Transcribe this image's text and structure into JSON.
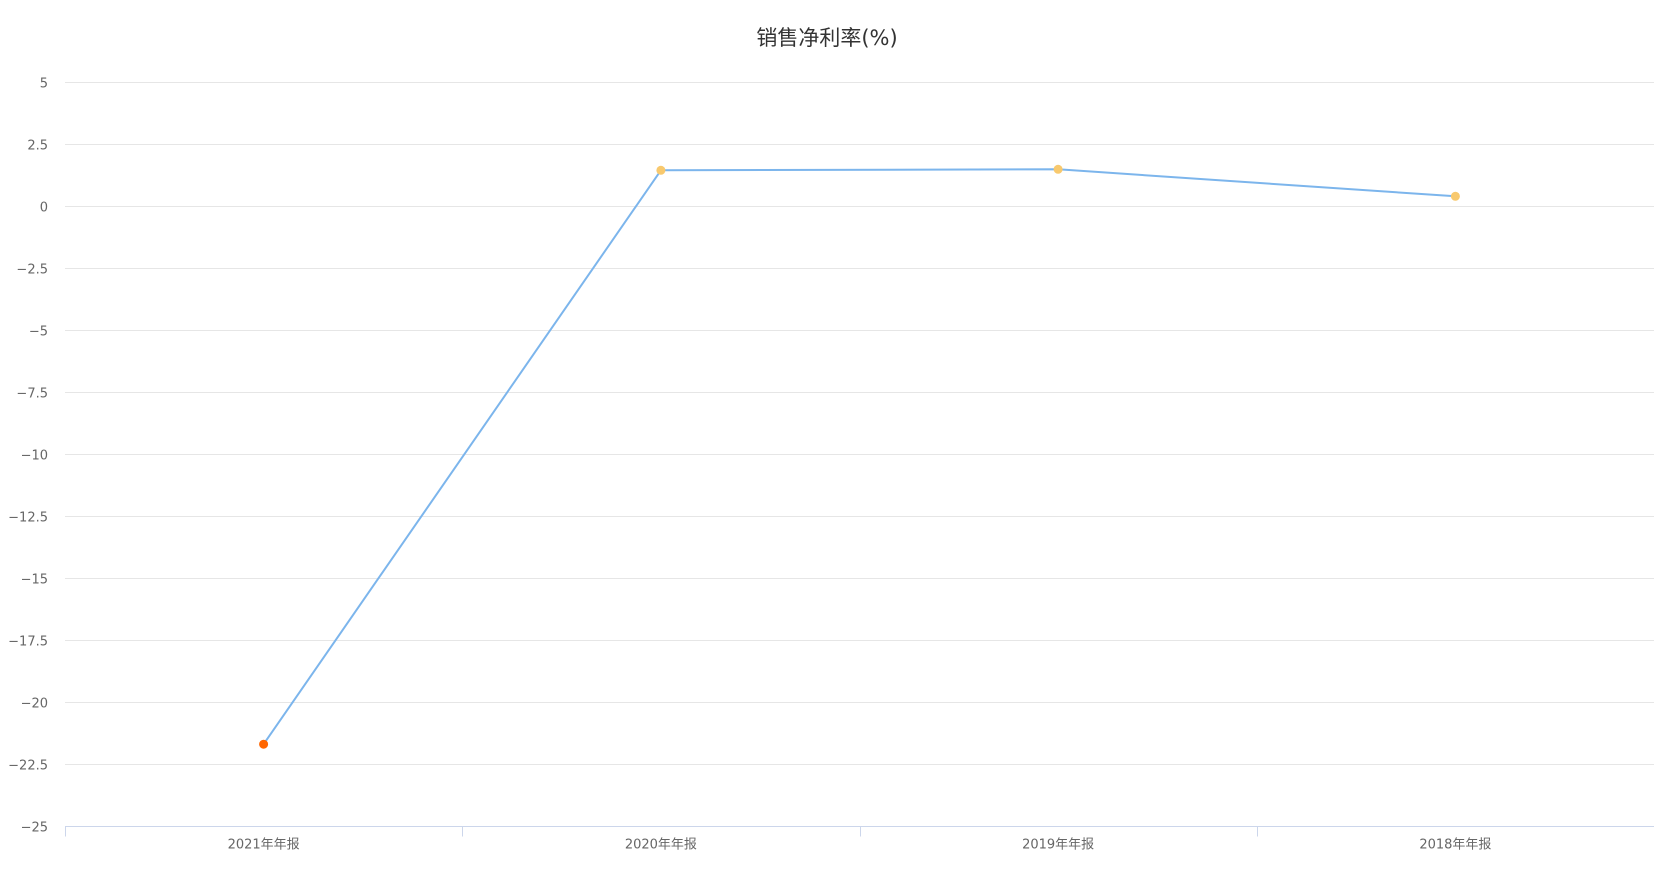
{
  "chart_data": {
    "type": "line",
    "title": "销售净利率(%)",
    "xlabel": "",
    "ylabel": "",
    "categories": [
      "2021年年报",
      "2020年年报",
      "2019年年报",
      "2018年年报"
    ],
    "series": [
      {
        "values": [
          -21.7,
          1.44,
          1.48,
          0.39
        ],
        "color": "#7cb5ec"
      }
    ],
    "point_colors": [
      "#ff6600",
      "#f8c96e",
      "#f8c96e",
      "#f8c96e"
    ],
    "ylim": [
      -25,
      5
    ],
    "yticks": [
      5,
      2.5,
      0,
      -2.5,
      -5,
      -7.5,
      -10,
      -12.5,
      -15,
      -17.5,
      -20,
      -22.5,
      -25
    ],
    "ytick_labels": [
      "5",
      "2.5",
      "0",
      "−2.5",
      "−5",
      "−7.5",
      "−10",
      "−12.5",
      "−15",
      "−17.5",
      "−20",
      "−22.5",
      "−25"
    ],
    "grid": true,
    "legend": "none"
  }
}
